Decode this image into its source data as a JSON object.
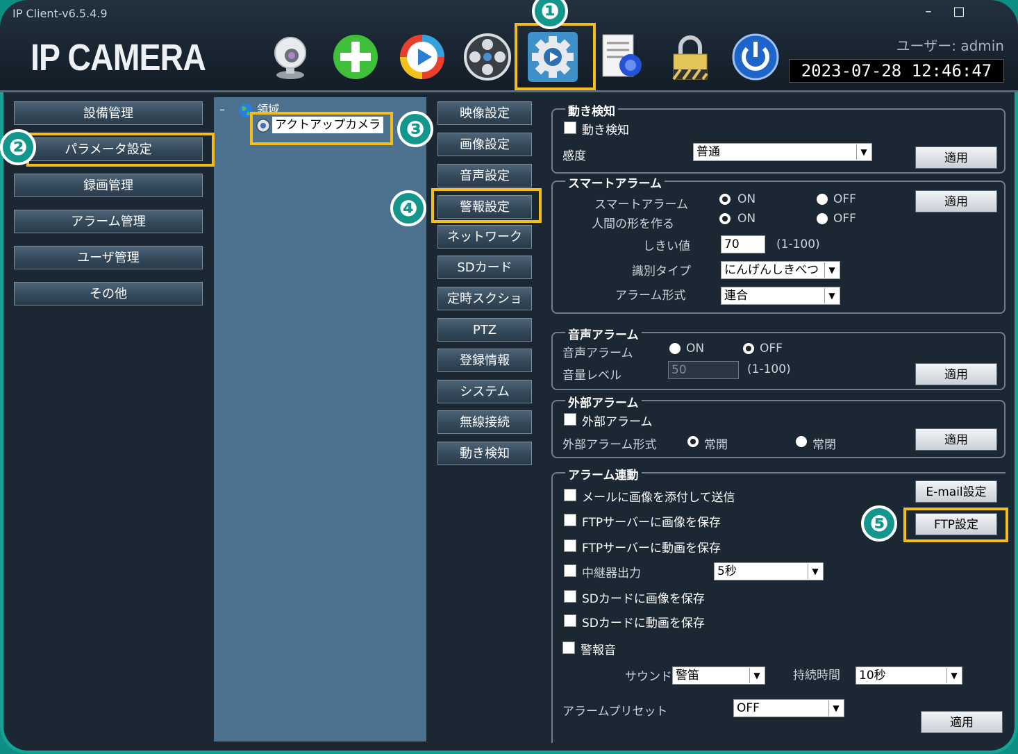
{
  "window": {
    "title": "IP Client-v6.5.4.9",
    "minimize": "–",
    "maximize": "□"
  },
  "header": {
    "logo": "IP CAMERA",
    "user": "ユーザー: admin",
    "datetime": "2023-07-28 12:46:47"
  },
  "toolbar": [
    {
      "icon": "webcam-icon"
    },
    {
      "icon": "add-icon"
    },
    {
      "icon": "play-icon"
    },
    {
      "icon": "film-reel-icon"
    },
    {
      "icon": "gear-icon"
    },
    {
      "icon": "report-icon"
    },
    {
      "icon": "lock-icon"
    },
    {
      "icon": "power-icon"
    }
  ],
  "badges": [
    "❶",
    "❷",
    "❸",
    "❹",
    "❺"
  ],
  "sidebar": {
    "items": [
      {
        "label": "設備管理"
      },
      {
        "label": "パラメータ設定"
      },
      {
        "label": "録画管理"
      },
      {
        "label": "アラーム管理"
      },
      {
        "label": "ユーザ管理"
      },
      {
        "label": "その他"
      }
    ]
  },
  "tree": {
    "root": "領域",
    "collapse": "–",
    "item": "アクトアップカメラ"
  },
  "submenu": [
    {
      "label": "映像設定"
    },
    {
      "label": "画像設定"
    },
    {
      "label": "音声設定"
    },
    {
      "label": "警報設定"
    },
    {
      "label": "ネットワーク"
    },
    {
      "label": "SDカード"
    },
    {
      "label": "定時スクショ"
    },
    {
      "label": "PTZ"
    },
    {
      "label": "登録情報"
    },
    {
      "label": "システム"
    },
    {
      "label": "無線接続"
    },
    {
      "label": "動き検知"
    }
  ],
  "motion": {
    "title": "動き検知",
    "checkbox": "動き検知",
    "sens_label": "感度",
    "sens_value": "普通",
    "apply": "適用"
  },
  "smart": {
    "title": "スマートアラーム",
    "row1": "スマートアラーム",
    "row2": "人間の形を作る",
    "on": "ON",
    "off": "OFF",
    "threshold_label": "しきい値",
    "threshold_value": "70",
    "threshold_range": "(1-100)",
    "type_label": "識別タイプ",
    "type_value": "にんげんしきべつ",
    "form_label": "アラーム形式",
    "form_value": "連合",
    "apply": "適用"
  },
  "audio": {
    "title": "音声アラーム",
    "label": "音声アラーム",
    "on": "ON",
    "off": "OFF",
    "vol_label": "音量レベル",
    "vol_value": "50",
    "vol_range": "(1-100)",
    "apply": "適用"
  },
  "external": {
    "title": "外部アラーム",
    "checkbox": "外部アラーム",
    "form_label": "外部アラーム形式",
    "opt1": "常開",
    "opt2": "常閉",
    "apply": "適用"
  },
  "link": {
    "title": "アラーム連動",
    "items": [
      "メールに画像を添付して送信",
      "FTPサーバーに画像を保存",
      "FTPサーバーに動画を保存",
      "中継器出力",
      "SDカードに画像を保存",
      "SDカードに動画を保存",
      "警報音"
    ],
    "relay_value": "5秒",
    "email_btn": "E-mail設定",
    "ftp_btn": "FTP設定",
    "sound_label": "サウンド",
    "sound_value": "警笛",
    "duration_label": "持続時間",
    "duration_value": "10秒",
    "preset_label": "アラームプリセット",
    "preset_value": "OFF",
    "apply": "適用"
  },
  "colors": {
    "highlight": "#f5bc1c",
    "badge": "#13978c",
    "frame": "#14a394"
  }
}
